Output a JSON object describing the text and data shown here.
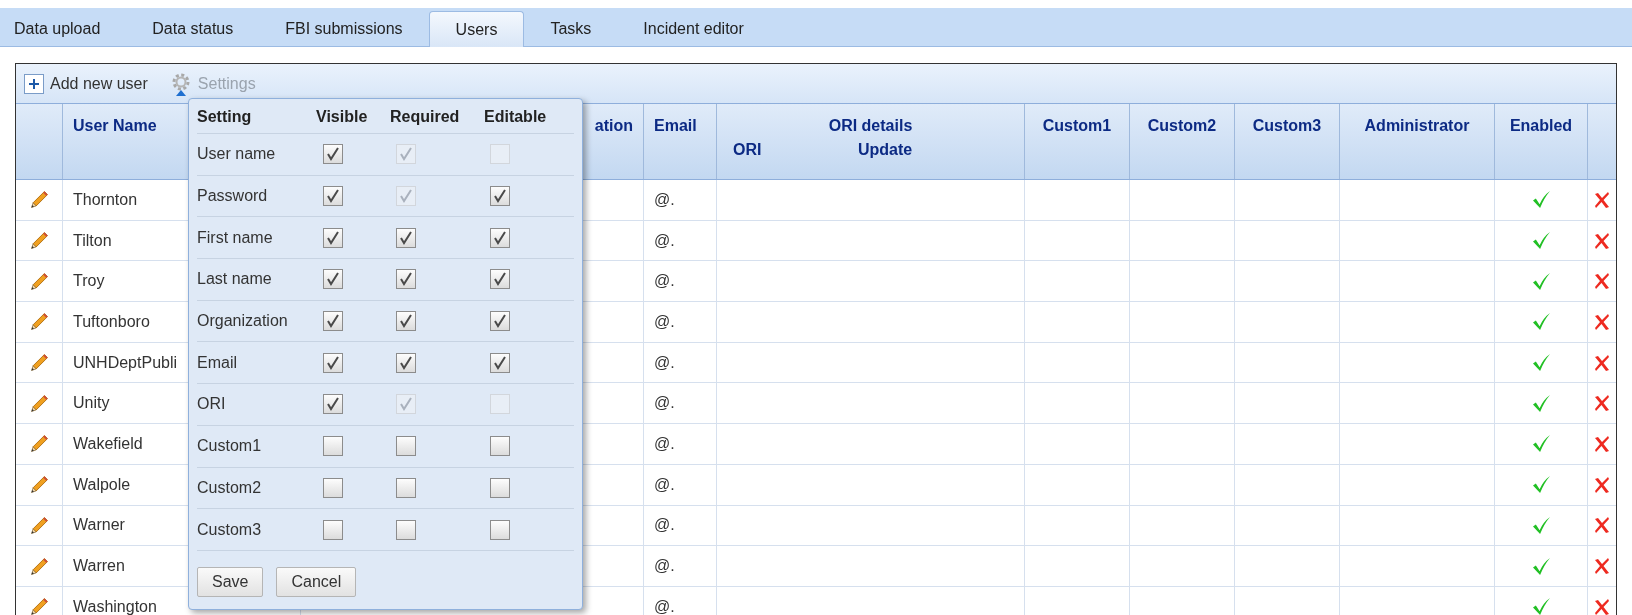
{
  "tabs": [
    {
      "label": "Data upload",
      "selected": false
    },
    {
      "label": "Data status",
      "selected": false
    },
    {
      "label": "FBI submissions",
      "selected": false
    },
    {
      "label": "Users",
      "selected": true
    },
    {
      "label": "Tasks",
      "selected": false
    },
    {
      "label": "Incident editor",
      "selected": false
    }
  ],
  "toolbar": {
    "add_button": "Add new user",
    "settings_button": "Settings"
  },
  "table": {
    "columns": [
      {
        "kind": "text",
        "label": "User Name"
      },
      {
        "kind": "text",
        "label": "ation"
      },
      {
        "kind": "text",
        "label": "Email"
      },
      {
        "kind": "group",
        "label": "ORI details",
        "sub_labels": [
          "ORI",
          "Update"
        ]
      },
      {
        "kind": "text",
        "label": "Custom1"
      },
      {
        "kind": "text",
        "label": "Custom2"
      },
      {
        "kind": "text",
        "label": "Custom3"
      },
      {
        "kind": "text",
        "label": "Administrator"
      },
      {
        "kind": "text",
        "label": "Enabled"
      }
    ],
    "rows": [
      {
        "user_name": "Thornton",
        "email": "@.",
        "enabled": true
      },
      {
        "user_name": "Tilton",
        "email": "@.",
        "enabled": true
      },
      {
        "user_name": "Troy",
        "email": "@.",
        "enabled": true
      },
      {
        "user_name": "Tuftonboro",
        "email": "@.",
        "enabled": true
      },
      {
        "user_name": "UNHDeptPubli",
        "email": "@.",
        "enabled": true
      },
      {
        "user_name": "Unity",
        "email": "@.",
        "enabled": true
      },
      {
        "user_name": "Wakefield",
        "email": "@.",
        "enabled": true
      },
      {
        "user_name": "Walpole",
        "email": "@.",
        "enabled": true
      },
      {
        "user_name": "Warner",
        "email": "@.",
        "enabled": true
      },
      {
        "user_name": "Warren",
        "email": "@.",
        "enabled": true
      },
      {
        "user_name": "Washington",
        "email": "@.",
        "enabled": true
      }
    ]
  },
  "settings_popup": {
    "columns": [
      "Setting",
      "Visible",
      "Required",
      "Editable"
    ],
    "rows": [
      {
        "label": "User name",
        "visible": {
          "checked": true,
          "disabled": false
        },
        "required": {
          "checked": true,
          "disabled": true
        },
        "editable": {
          "checked": false,
          "disabled": true
        }
      },
      {
        "label": "Password",
        "visible": {
          "checked": true,
          "disabled": false
        },
        "required": {
          "checked": true,
          "disabled": true
        },
        "editable": {
          "checked": true,
          "disabled": false
        }
      },
      {
        "label": "First name",
        "visible": {
          "checked": true,
          "disabled": false
        },
        "required": {
          "checked": true,
          "disabled": false
        },
        "editable": {
          "checked": true,
          "disabled": false
        }
      },
      {
        "label": "Last name",
        "visible": {
          "checked": true,
          "disabled": false
        },
        "required": {
          "checked": true,
          "disabled": false
        },
        "editable": {
          "checked": true,
          "disabled": false
        }
      },
      {
        "label": "Organization",
        "visible": {
          "checked": true,
          "disabled": false
        },
        "required": {
          "checked": true,
          "disabled": false
        },
        "editable": {
          "checked": true,
          "disabled": false
        }
      },
      {
        "label": "Email",
        "visible": {
          "checked": true,
          "disabled": false
        },
        "required": {
          "checked": true,
          "disabled": false
        },
        "editable": {
          "checked": true,
          "disabled": false
        }
      },
      {
        "label": "ORI",
        "visible": {
          "checked": true,
          "disabled": false
        },
        "required": {
          "checked": true,
          "disabled": true
        },
        "editable": {
          "checked": false,
          "disabled": true
        }
      },
      {
        "label": "Custom1",
        "visible": {
          "checked": false,
          "disabled": false
        },
        "required": {
          "checked": false,
          "disabled": false
        },
        "editable": {
          "checked": false,
          "disabled": false
        }
      },
      {
        "label": "Custom2",
        "visible": {
          "checked": false,
          "disabled": false
        },
        "required": {
          "checked": false,
          "disabled": false
        },
        "editable": {
          "checked": false,
          "disabled": false
        }
      },
      {
        "label": "Custom3",
        "visible": {
          "checked": false,
          "disabled": false
        },
        "required": {
          "checked": false,
          "disabled": false
        },
        "editable": {
          "checked": false,
          "disabled": false
        }
      }
    ],
    "buttons": [
      "Save",
      "Cancel"
    ]
  }
}
